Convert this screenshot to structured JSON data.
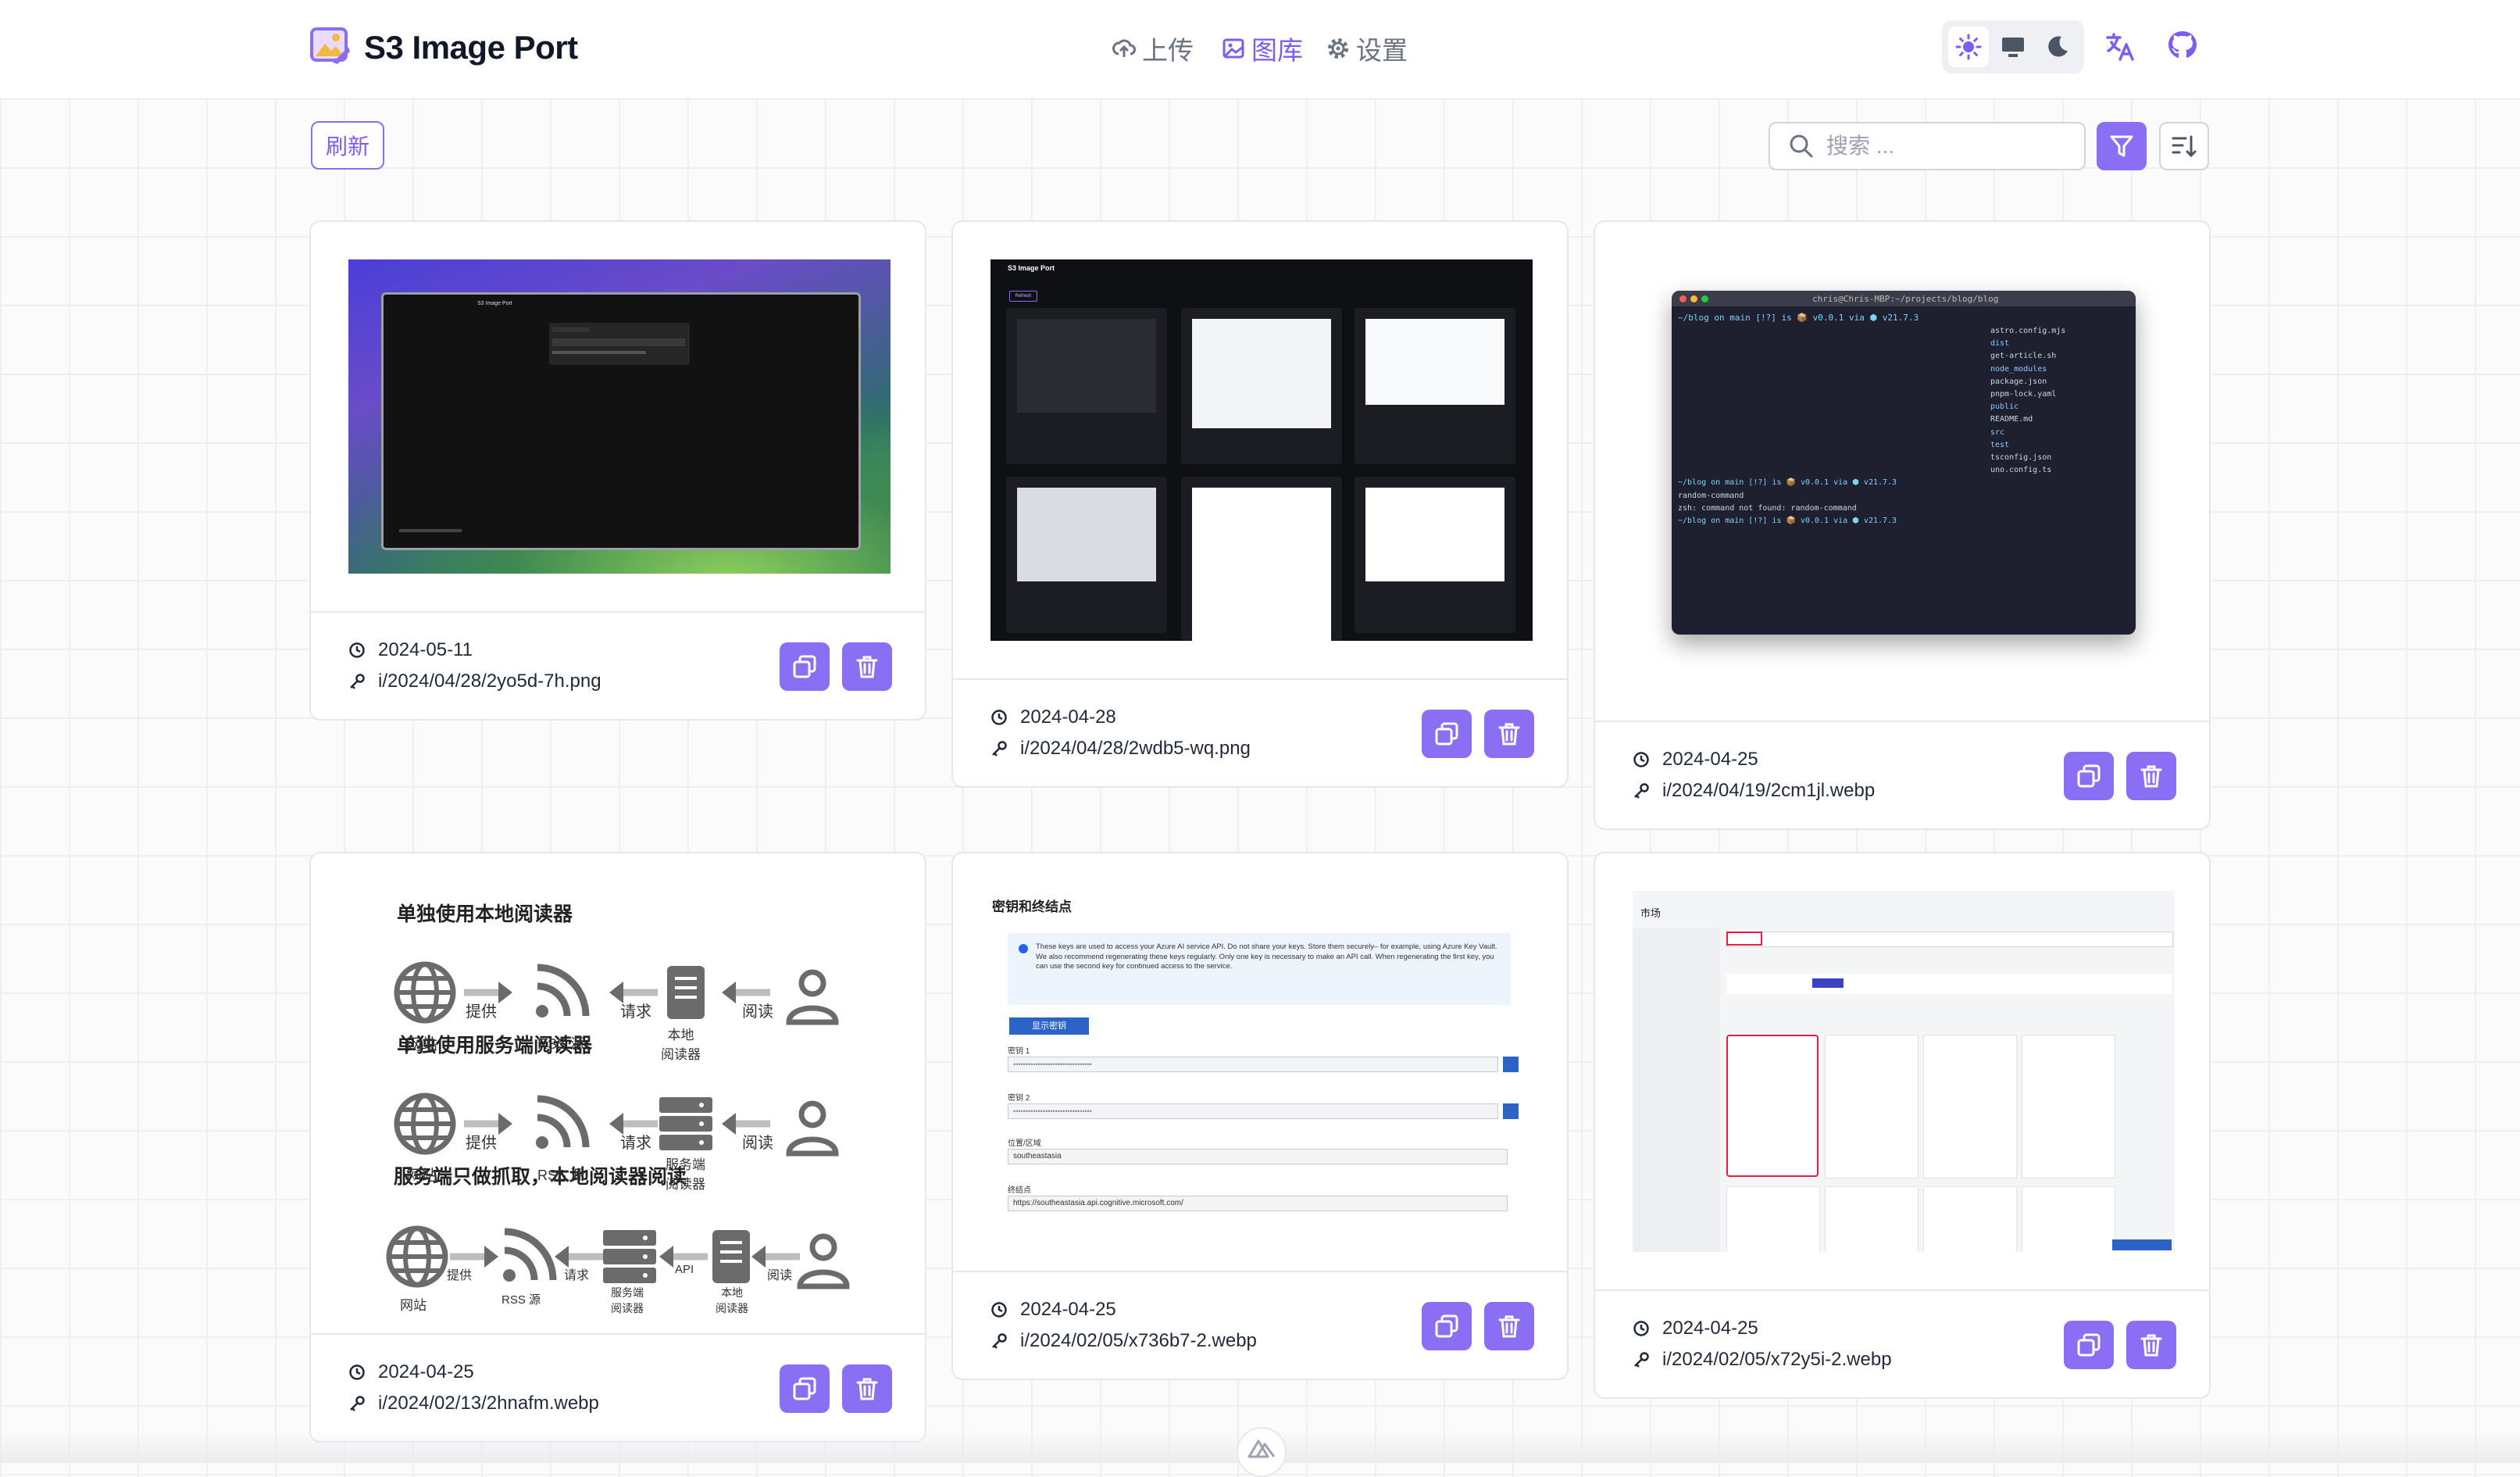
{
  "app": {
    "title": "S3 Image Port"
  },
  "nav": [
    {
      "label": "上传",
      "icon": "upload-cloud-icon",
      "active": false
    },
    {
      "label": "图库",
      "icon": "image-icon",
      "active": true
    },
    {
      "label": "设置",
      "icon": "gear-icon",
      "active": false
    }
  ],
  "theme": {
    "options": [
      "sun-icon",
      "monitor-icon",
      "moon-icon"
    ],
    "selected": "sun-icon"
  },
  "toolbar": {
    "refresh_label": "刷新",
    "search_placeholder": "搜索 ..."
  },
  "colors": {
    "accent": "#8a6ff5",
    "accent_text": "#7c5cf2",
    "border": "#e6e7eb"
  },
  "images": [
    {
      "date": "2024-05-11",
      "path": "i/2024/04/28/2yo5d-7h.png"
    },
    {
      "date": "2024-04-28",
      "path": "i/2024/04/28/2wdb5-wq.png"
    },
    {
      "date": "2024-04-25",
      "path": "i/2024/04/19/2cm1jl.webp"
    },
    {
      "date": "2024-04-25",
      "path": "i/2024/02/13/2hnafm.webp"
    },
    {
      "date": "2024-04-25",
      "path": "i/2024/02/05/x736b7-2.webp"
    },
    {
      "date": "2024-04-25",
      "path": "i/2024/02/05/x72y5i-2.webp"
    }
  ],
  "thumbs": {
    "rss": {
      "h1": "单独使用本地阅读器",
      "h2": "单独使用服务端阅读器",
      "h3": "服务端只做抓取，本地阅读器阅读",
      "website": "网站",
      "provide": "提供",
      "rss": "RSS 源",
      "request": "请求",
      "local_reader": "本地\n阅读器",
      "read": "阅读",
      "server_reader": "服务端\n阅读器",
      "api": "API"
    },
    "keys": {
      "title": "密钥和终结点",
      "info": "These keys are used to access your Azure AI service API. Do not share your keys. Store them securely– for example, using Azure Key Vault. We also recommend regenerating these keys regularly. Only one key is necessary to make an API call. When regenerating the first key, you can use the second key for continued access to the service.",
      "show_keys": "显示密钥",
      "key1": "密钥 1",
      "key2": "密钥 2",
      "masked": "••••••••••••••••••••••••••••••••",
      "location_label": "位置/区域",
      "location": "southeastasia",
      "endpoint_label": "终结点",
      "endpoint": "https://southeastasia.api.cognitive.microsoft.com/"
    },
    "terminal": {
      "title": "chris@Chris-MBP:~/projects/blog/blog",
      "prompt": "~/blog on  main [!?] is 📦 v0.0.1 via ⬢ v21.7.3",
      "files": [
        "astro.config.mjs",
        "dist",
        "get-article.sh",
        "node_modules",
        "package.json",
        "pnpm-lock.yaml",
        "public",
        "README.md",
        "src",
        "test",
        "tsconfig.json",
        "uno.config.ts"
      ],
      "cmd": "random-command",
      "err": "zsh: command not found: random-command"
    },
    "market": {
      "title": "市场"
    },
    "app_shot": {
      "title": "S3 Image Port",
      "refresh": "Refresh"
    }
  }
}
